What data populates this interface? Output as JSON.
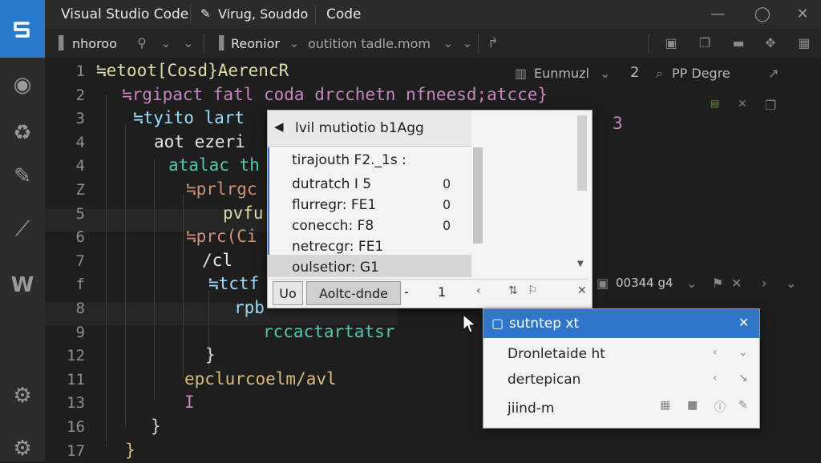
{
  "app_title": "Visual Studio Code",
  "window_subtitle": "Virug, Souddo",
  "menu_code": "Code",
  "tabs": [
    {
      "label": "nhoroo"
    },
    {
      "label": "Reonior"
    }
  ],
  "file_path": "outition tadle.mom",
  "right_header": {
    "label": "Eunmuzl",
    "num": "2",
    "extra": "PP Degre"
  },
  "code_lines": [
    {
      "num": "1",
      "text": "≒etoot[Cosd}AerencR",
      "color": "#dcdcaa"
    },
    {
      "num": "2",
      "text": "≒rgipact fatl coda drcchetn nfneesd;atcce}",
      "color": "#c586c0"
    },
    {
      "num": "3",
      "text": "≒tyito lart",
      "color": "#9cdcfe"
    },
    {
      "num": "4",
      "text": "aot ezeri",
      "color": "#e6e6e6"
    },
    {
      "num": "4",
      "text": "atalac th",
      "color": "#4ec9b0"
    },
    {
      "num": "Z",
      "text": "≒prlrgc",
      "color": "#ce9178"
    },
    {
      "num": "5",
      "text": "pvfu",
      "color": "#dcdcaa"
    },
    {
      "num": "6",
      "text": "≒prc(Ci",
      "color": "#ce9178"
    },
    {
      "num": "7",
      "text": "/cl",
      "color": "#e6e6e6"
    },
    {
      "num": "f",
      "text": "≒tctf",
      "color": "#9cdcfe"
    },
    {
      "num": "8",
      "text": "rpb",
      "color": "#9cdcfe"
    },
    {
      "num": "9",
      "text": "rccactartatsr",
      "color": "#4ec9b0"
    },
    {
      "num": "12",
      "text": "}",
      "color": "#d4d4d4"
    },
    {
      "num": "11",
      "text": "epclurcoelm/avl",
      "color": "#d7ba7d"
    },
    {
      "num": "13",
      "text": "I",
      "color": "#c586c0"
    },
    {
      "num": "16",
      "text": "}",
      "color": "#d4d4d4"
    },
    {
      "num": "17",
      "text": "}",
      "color": "#d7ba7d"
    }
  ],
  "stray_digit": "3",
  "popup": {
    "header": "lvil mutiotio b1Agg",
    "items": [
      {
        "label": "tirajouth F2._1s :",
        "value": ""
      },
      {
        "label": "dutratch I 5",
        "value": "0"
      },
      {
        "label": "flurregr: FE1",
        "value": "0"
      },
      {
        "label": "conecch: F8",
        "value": "0"
      },
      {
        "label": "netrecgr: FE1",
        "value": ""
      },
      {
        "label": "oulsetior: G1",
        "value": ""
      }
    ],
    "footer": {
      "btn1": "Uo",
      "btn2": "Aoltc-dnde",
      "dash": "-",
      "num": "1"
    }
  },
  "status_mid": "00344 g4",
  "panel": {
    "title": "sutntep xt",
    "rows": [
      {
        "label": "Dronletaide ht"
      },
      {
        "label": "dertepican"
      },
      {
        "label": "jiind-m"
      }
    ]
  }
}
